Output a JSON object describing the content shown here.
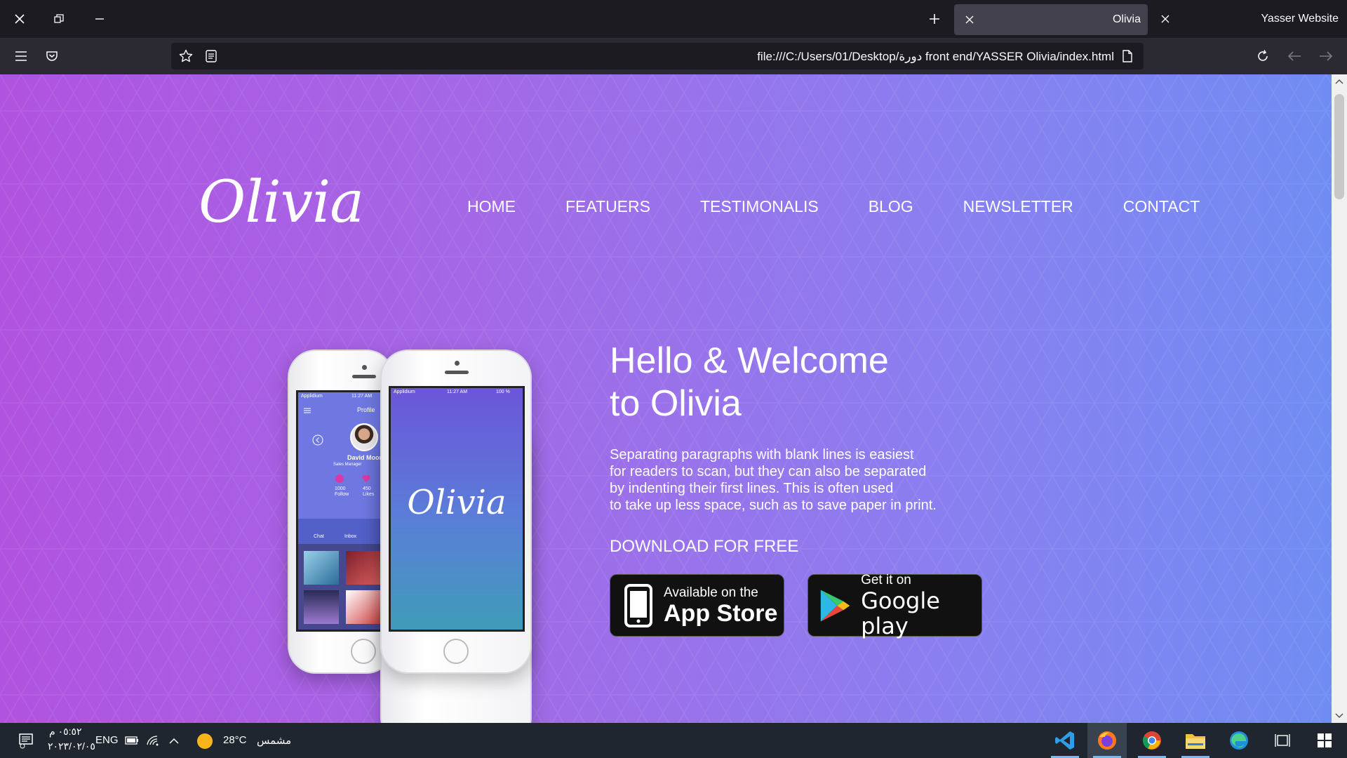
{
  "browser": {
    "tab_title": "Olivia",
    "profile_name": "Yasser Website",
    "url": "file:///C:/Users/01/Desktop/دورة front end/YASSER Olivia/index.html"
  },
  "page": {
    "logo": "Olivia",
    "nav": [
      "HOME",
      "FEATUERS",
      "TESTIMONALIS",
      "BLOG",
      "NEWSLETTER",
      "CONTACT"
    ],
    "hero_title_line1": "Hello & Welcome",
    "hero_title_line2": "to Olivia",
    "hero_paragraph": [
      "Separating paragraphs with blank lines is easiest",
      "for readers to scan, but they can also be separated",
      "by indenting their first lines. This is often used",
      "to take up less space, such as to save paper in print."
    ],
    "download_heading": "DOWNLOAD FOR FREE",
    "app_store": {
      "small": "Available on the",
      "big": "App Store"
    },
    "google_play": {
      "small": "Get it on",
      "big": "Google play"
    },
    "phone_left": {
      "carrier": "Applidium",
      "time": "11:27 AM",
      "screen_title": "Profile",
      "user_name": "David Moor",
      "user_role": "Sales Manager",
      "follow_count": "1000",
      "follow_label": "Follow",
      "likes_count": "450",
      "likes_label": "Likes",
      "tab_chat": "Chat",
      "tab_inbox": "Inbox"
    },
    "phone_right": {
      "carrier": "Applidium",
      "time": "11:27 AM",
      "battery": "100 %",
      "splash": "Olivia"
    }
  },
  "taskbar": {
    "time": "٠٥:٥٢ م",
    "date": "٢٠٢٣/٠٢/٠٥",
    "lang": "ENG",
    "temperature": "28°C",
    "weather": "مشمس"
  },
  "colors": {
    "gradient_start": "#b053e0",
    "gradient_end": "#6f8df3",
    "tab_active": "#42414d",
    "toolbar": "#2b2a33",
    "taskbar": "#1f2630"
  }
}
